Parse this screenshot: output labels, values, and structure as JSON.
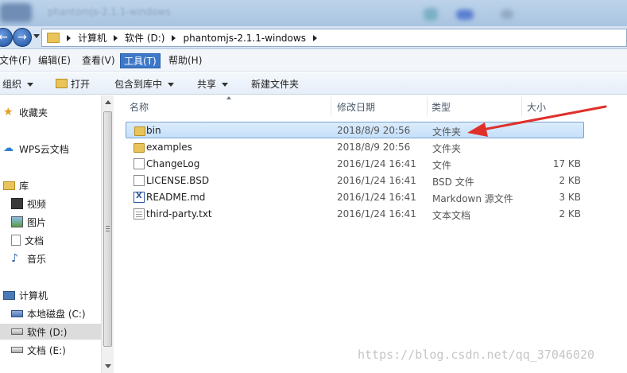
{
  "window": {
    "blurred_title": "phantomjs-2.1.1-windows"
  },
  "address": {
    "crumbs": [
      "计算机",
      "软件 (D:)",
      "phantomjs-2.1.1-windows"
    ]
  },
  "menu": {
    "items": [
      "文件(F)",
      "编辑(E)",
      "查看(V)",
      "工具(T)",
      "帮助(H)"
    ],
    "active_index": 3
  },
  "toolbar": {
    "organize": "组织",
    "open": "打开",
    "include_library": "包含到库中",
    "share": "共享",
    "new_folder": "新建文件夹"
  },
  "nav": {
    "favorites": "收藏夹",
    "wps_cloud": "WPS云文档",
    "libraries": "库",
    "videos": "视频",
    "pictures": "图片",
    "documents": "文档",
    "music": "音乐",
    "computer": "计算机",
    "local_disk_c": "本地磁盘 (C:)",
    "software_d": "软件 (D:)",
    "docs_e": "文档 (E:)"
  },
  "columns": {
    "name": "名称",
    "modified": "修改日期",
    "type": "类型",
    "size": "大小"
  },
  "files": [
    {
      "name": "bin",
      "modified": "2018/8/9 20:56",
      "type": "文件夹",
      "size": "",
      "icon": "folder-icon"
    },
    {
      "name": "examples",
      "modified": "2018/8/9 20:56",
      "type": "文件夹",
      "size": "",
      "icon": "folder-icon"
    },
    {
      "name": "ChangeLog",
      "modified": "2016/1/24 16:41",
      "type": "文件",
      "size": "17 KB",
      "icon": "file-icon"
    },
    {
      "name": "LICENSE.BSD",
      "modified": "2016/1/24 16:41",
      "type": "BSD 文件",
      "size": "2 KB",
      "icon": "file-icon"
    },
    {
      "name": "README.md",
      "modified": "2016/1/24 16:41",
      "type": "Markdown 源文件",
      "size": "3 KB",
      "icon": "markdown-file-icon"
    },
    {
      "name": "third-party.txt",
      "modified": "2016/1/24 16:41",
      "type": "文本文档",
      "size": "2 KB",
      "icon": "text-file-icon"
    }
  ],
  "selected_file_index": 0,
  "watermark": "https://blog.csdn.net/qq_37046020",
  "colors": {
    "accent": "#3d78c9",
    "arrow": "#e0302a",
    "selection": "#c4e0fa"
  }
}
